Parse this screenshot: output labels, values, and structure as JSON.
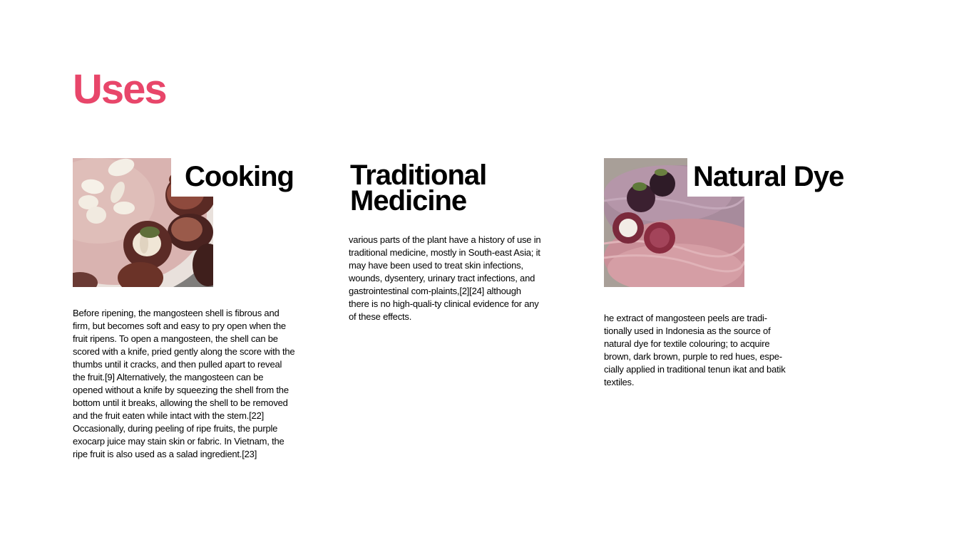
{
  "page": {
    "title": "Uses",
    "accent_color": "#e8466a"
  },
  "sections": [
    {
      "heading": "Cooking",
      "image": "mangosteen-plate-photo",
      "text": "Before ripening, the mangosteen shell is fibrous and firm, but becomes soft and easy to pry open when the fruit ripens. To open a mangosteen, the shell can be scored with a knife, pried gently along the score with the thumbs until it cracks, and then pulled apart to reveal the fruit.[9] Alternatively, the mangosteen can be opened without a knife by squeezing the shell from the bottom until it breaks, allowing the shell to be removed and the fruit eaten while intact with the stem.[22] Occasionally, during peeling of ripe fruits, the purple exocarp juice may stain skin or fabric. In Vietnam, the ripe fruit is also used as a salad ingredient.[23]"
    },
    {
      "heading": "Traditional Medicine",
      "text": "various parts of the plant have a history of use in traditional medicine, mostly in South-east Asia; it may have been used to treat skin infections, wounds, dysentery, urinary tract infections, and gastrointestinal com-plaints,[2][24] although there is no high-quali-ty clinical evidence for any of these effects."
    },
    {
      "heading": "Natural Dye",
      "image": "dyed-yarn-photo",
      "text": "he extract of mangosteen peels are tradi-tionally used in Indonesia as the source of natural dye for textile colouring; to acquire brown, dark brown, purple to red hues, espe-cially applied in traditional tenun ikat and batik textiles."
    }
  ]
}
